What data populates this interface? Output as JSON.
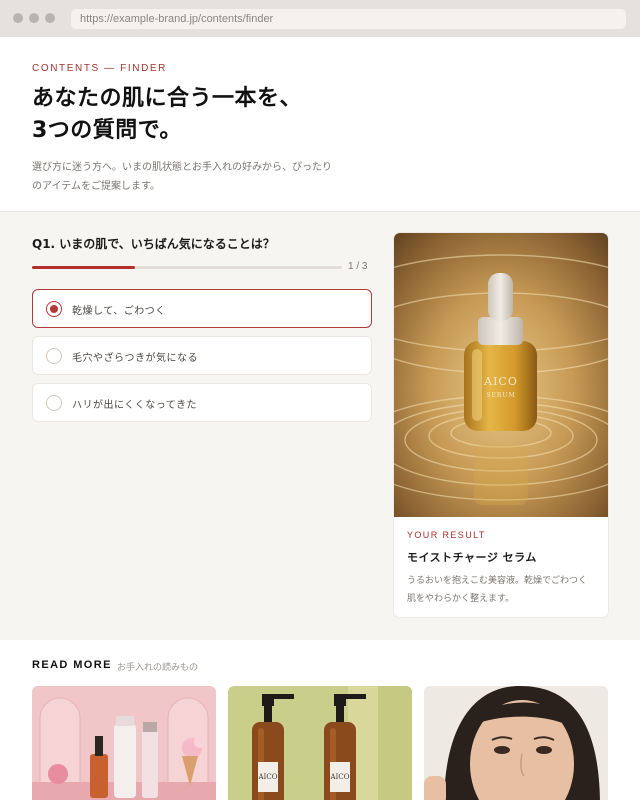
{
  "browser": {
    "url": "https://example-brand.jp/contents/finder"
  },
  "hero": {
    "eyebrow": "CONTENTS — FINDER",
    "headline_line1": "あなたの肌に合う一本を、",
    "headline_line2": "3つの質問で。",
    "lede_line1": "選び方に迷う方へ。いまの肌状態とお手入れの好みから、ぴったり",
    "lede_line2": "のアイテムをご提案します。"
  },
  "quiz": {
    "question": "Q1. いまの肌で、いちばん気になることは？",
    "progress_current": 1,
    "progress_total": 3,
    "progress_label": "1 / 3",
    "options": [
      {
        "label": "乾燥して、ごわつく",
        "selected": true
      },
      {
        "label": "毛穴やざらつきが気になる",
        "selected": false
      },
      {
        "label": "ハリが出にくくなってきた",
        "selected": false
      }
    ]
  },
  "result": {
    "eyebrow": "YOUR RESULT",
    "title": "モイストチャージ セラム",
    "desc_line1": "うるおいを抱えこむ美容液。乾燥でごわつく",
    "desc_line2": "肌をやわらかく整えます。",
    "bottle_brand": "AICO",
    "bottle_sub": "SERUM"
  },
  "read_more": {
    "label": "READ MORE",
    "sub": "お手入れの読みもの",
    "articles": [
      {
        "image": "pink-skincare-products-photo"
      },
      {
        "image": "amber-pump-bottles-photo",
        "bottle_brand": "AICO"
      },
      {
        "image": "woman-face-closeup-photo"
      }
    ]
  },
  "colors": {
    "accent": "#b23a36",
    "bg": "#f7f5f2"
  }
}
